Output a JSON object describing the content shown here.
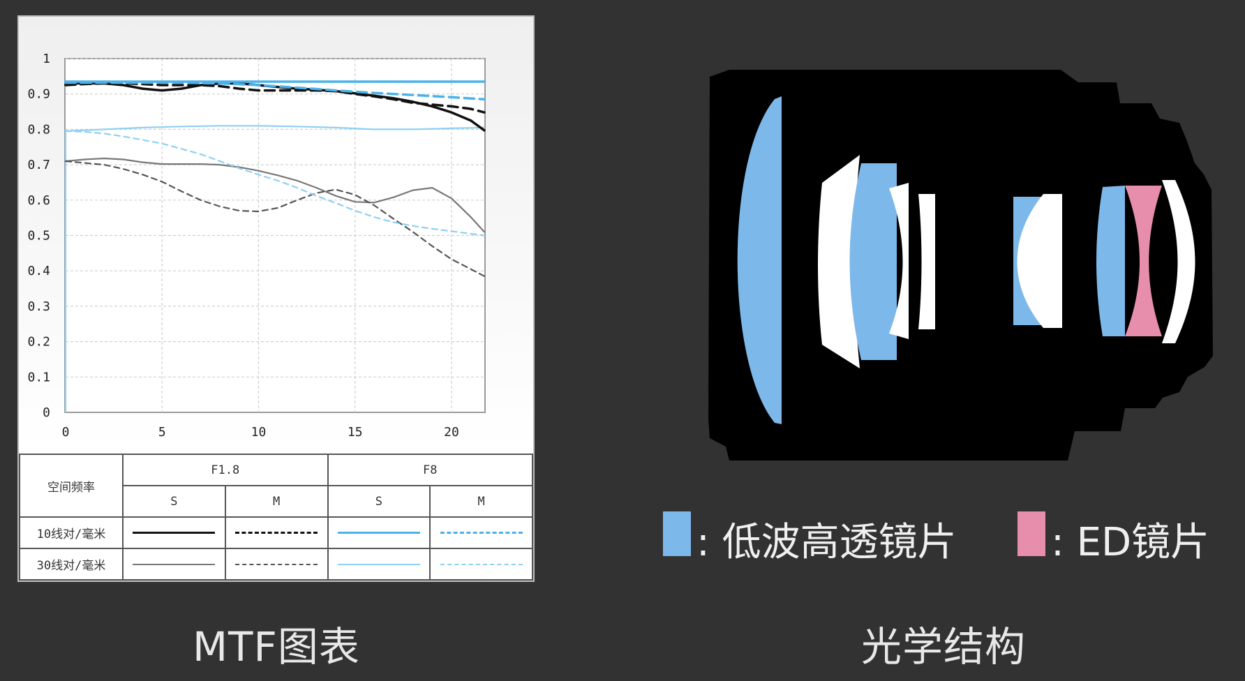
{
  "chart_data": {
    "type": "line",
    "title": "",
    "xlabel": "",
    "ylabel": "",
    "xlim": [
      0,
      21.7
    ],
    "ylim": [
      0,
      1
    ],
    "xticks": [
      "0",
      "5",
      "10",
      "15",
      "20"
    ],
    "yticks": [
      "0",
      "0.1",
      "0.2",
      "0.3",
      "0.4",
      "0.5",
      "0.6",
      "0.7",
      "0.8",
      "0.9",
      "1"
    ],
    "grid": true,
    "series": [
      {
        "freq": "10线对/毫米",
        "aperture": "F1.8",
        "orient": "S",
        "color": "#111111",
        "width": 3.5,
        "dash": "",
        "x": [
          0,
          1,
          2,
          3,
          4,
          5,
          6,
          7,
          8,
          9,
          10,
          11,
          12,
          13,
          14,
          15,
          16,
          17,
          18,
          19,
          20,
          21,
          21.7
        ],
        "y": [
          0.93,
          0.93,
          0.93,
          0.925,
          0.915,
          0.91,
          0.915,
          0.925,
          0.93,
          0.93,
          0.925,
          0.92,
          0.915,
          0.912,
          0.908,
          0.902,
          0.895,
          0.888,
          0.878,
          0.865,
          0.848,
          0.825,
          0.797
        ]
      },
      {
        "freq": "10线对/毫米",
        "aperture": "F1.8",
        "orient": "M",
        "color": "#111111",
        "width": 3.5,
        "dash": "14,8",
        "x": [
          0,
          1,
          2,
          3,
          4,
          5,
          6,
          7,
          8,
          9,
          10,
          11,
          12,
          13,
          14,
          15,
          16,
          17,
          18,
          19,
          20,
          21,
          21.7
        ],
        "y": [
          0.925,
          0.928,
          0.93,
          0.93,
          0.928,
          0.925,
          0.925,
          0.925,
          0.922,
          0.915,
          0.91,
          0.91,
          0.91,
          0.91,
          0.908,
          0.9,
          0.893,
          0.885,
          0.875,
          0.87,
          0.865,
          0.858,
          0.848
        ]
      },
      {
        "freq": "10线对/毫米",
        "aperture": "F8",
        "orient": "S",
        "color": "#4ab2ea",
        "width": 3.5,
        "dash": "",
        "x": [
          0,
          21.7
        ],
        "y": [
          0.935,
          0.935
        ]
      },
      {
        "freq": "10线对/毫米",
        "aperture": "F8",
        "orient": "M",
        "color": "#4ab2ea",
        "width": 3.5,
        "dash": "14,8",
        "x": [
          0,
          2,
          4,
          6,
          8,
          10,
          12,
          14,
          16,
          18,
          20,
          21.7
        ],
        "y": [
          0.932,
          0.932,
          0.932,
          0.932,
          0.93,
          0.925,
          0.918,
          0.91,
          0.903,
          0.897,
          0.891,
          0.885
        ]
      },
      {
        "freq": "30线对/毫米",
        "aperture": "F1.8",
        "orient": "S",
        "color": "#777777",
        "width": 2.2,
        "dash": "",
        "x": [
          0,
          1,
          2,
          3,
          4,
          5,
          6,
          7,
          8,
          9,
          10,
          11,
          12,
          13,
          14,
          15,
          16,
          17,
          18,
          19,
          20,
          21,
          21.7
        ],
        "y": [
          0.71,
          0.715,
          0.718,
          0.715,
          0.707,
          0.702,
          0.702,
          0.702,
          0.7,
          0.693,
          0.683,
          0.67,
          0.655,
          0.635,
          0.612,
          0.595,
          0.593,
          0.608,
          0.628,
          0.635,
          0.605,
          0.552,
          0.51
        ]
      },
      {
        "freq": "30线对/毫米",
        "aperture": "F1.8",
        "orient": "M",
        "color": "#555555",
        "width": 2.2,
        "dash": "8,6",
        "x": [
          0,
          1,
          2,
          3,
          4,
          5,
          6,
          7,
          8,
          9,
          10,
          11,
          12,
          13,
          14,
          15,
          16,
          17,
          18,
          19,
          20,
          21,
          21.7
        ],
        "y": [
          0.71,
          0.705,
          0.7,
          0.688,
          0.672,
          0.652,
          0.625,
          0.6,
          0.582,
          0.57,
          0.568,
          0.578,
          0.6,
          0.62,
          0.63,
          0.615,
          0.585,
          0.547,
          0.51,
          0.47,
          0.433,
          0.405,
          0.385
        ]
      },
      {
        "freq": "30线对/毫米",
        "aperture": "F8",
        "orient": "S",
        "color": "#8fd0f3",
        "width": 2.2,
        "dash": "",
        "x": [
          0,
          2,
          4,
          6,
          8,
          10,
          12,
          14,
          16,
          18,
          20,
          21.7
        ],
        "y": [
          0.795,
          0.8,
          0.805,
          0.808,
          0.81,
          0.81,
          0.808,
          0.805,
          0.8,
          0.8,
          0.803,
          0.805
        ]
      },
      {
        "freq": "30线对/毫米",
        "aperture": "F8",
        "orient": "M",
        "color": "#8fd0f3",
        "width": 2.2,
        "dash": "8,6",
        "x": [
          0,
          1,
          2,
          3,
          4,
          5,
          6,
          7,
          8,
          9,
          10,
          11,
          12,
          13,
          14,
          15,
          16,
          17,
          18,
          19,
          20,
          21,
          21.7
        ],
        "y": [
          0.795,
          0.793,
          0.788,
          0.78,
          0.77,
          0.76,
          0.745,
          0.73,
          0.71,
          0.69,
          0.672,
          0.655,
          0.635,
          0.612,
          0.592,
          0.57,
          0.552,
          0.537,
          0.527,
          0.519,
          0.512,
          0.505,
          0.5
        ]
      }
    ]
  },
  "legend_table": {
    "corner": "空间频率",
    "apertures": [
      "F1.8",
      "F8"
    ],
    "orients": [
      "S",
      "M",
      "S",
      "M"
    ],
    "rows": [
      "10线对/毫米",
      "30线对/毫米"
    ]
  },
  "captions": {
    "mtf": "MTF图表",
    "optics": "光学结构"
  },
  "lens_key": {
    "low_wave_label": ": 低波高透镜片",
    "low_wave_color": "#7db8ea",
    "ed_label": ": ED镜片",
    "ed_color": "#e68eac"
  }
}
